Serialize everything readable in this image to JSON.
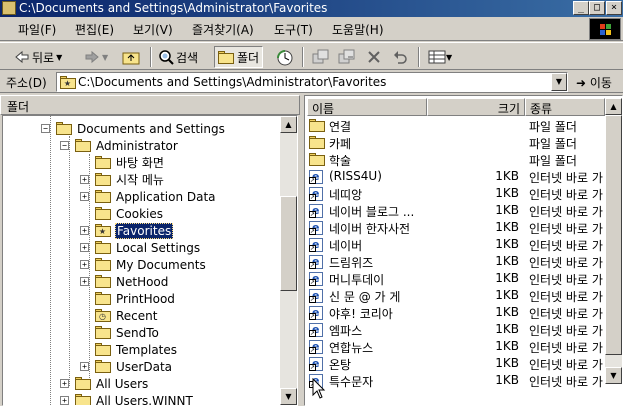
{
  "window": {
    "title": "C:\\Documents and Settings\\Administrator\\Favorites",
    "minimize": "_",
    "maximize": "□",
    "close": "×"
  },
  "menu": [
    {
      "label": "파일(F)"
    },
    {
      "label": "편집(E)"
    },
    {
      "label": "보기(V)"
    },
    {
      "label": "즐겨찾기(A)"
    },
    {
      "label": "도구(T)"
    },
    {
      "label": "도움말(H)"
    }
  ],
  "toolbar": {
    "back_label": "뒤로",
    "search_label": "검색",
    "folders_label": "폴더"
  },
  "address": {
    "label": "주소(D)",
    "value": "C:\\Documents and Settings\\Administrator\\Favorites",
    "go_label": "이동"
  },
  "folder_pane": {
    "header": "폴더",
    "items": [
      {
        "label": "Documents and Settings"
      },
      {
        "label": "Administrator"
      },
      {
        "label": "바탕 화면"
      },
      {
        "label": "시작 메뉴"
      },
      {
        "label": "Application Data"
      },
      {
        "label": "Cookies"
      },
      {
        "label": "Favorites"
      },
      {
        "label": "Local Settings"
      },
      {
        "label": "My Documents"
      },
      {
        "label": "NetHood"
      },
      {
        "label": "PrintHood"
      },
      {
        "label": "Recent"
      },
      {
        "label": "SendTo"
      },
      {
        "label": "Templates"
      },
      {
        "label": "UserData"
      },
      {
        "label": "All Users"
      },
      {
        "label": "All Users.WINNT"
      }
    ]
  },
  "file_list": {
    "columns": {
      "name": "이름",
      "size": "크기",
      "type": "종류"
    },
    "rows": [
      {
        "name": "연결",
        "size": "",
        "type": "파일 폴더",
        "icon": "folder-icon"
      },
      {
        "name": "카페",
        "size": "",
        "type": "파일 폴더",
        "icon": "folder-icon"
      },
      {
        "name": "학술",
        "size": "",
        "type": "파일 폴더",
        "icon": "folder-icon"
      },
      {
        "name": "(RISS4U)",
        "size": "1KB",
        "type": "인터넷 바로 가",
        "icon": "internet-shortcut-icon"
      },
      {
        "name": "네띠앙",
        "size": "1KB",
        "type": "인터넷 바로 가",
        "icon": "internet-shortcut-icon"
      },
      {
        "name": "네이버 블로그 ...",
        "size": "1KB",
        "type": "인터넷 바로 가",
        "icon": "internet-shortcut-icon"
      },
      {
        "name": "네이버 한자사전",
        "size": "1KB",
        "type": "인터넷 바로 가",
        "icon": "internet-shortcut-icon"
      },
      {
        "name": "네이버",
        "size": "1KB",
        "type": "인터넷 바로 가",
        "icon": "internet-shortcut-icon"
      },
      {
        "name": "드림위즈",
        "size": "1KB",
        "type": "인터넷 바로 가",
        "icon": "internet-shortcut-icon"
      },
      {
        "name": "머니투데이",
        "size": "1KB",
        "type": "인터넷 바로 가",
        "icon": "internet-shortcut-icon"
      },
      {
        "name": "신 문 @ 가 게",
        "size": "1KB",
        "type": "인터넷 바로 가",
        "icon": "internet-shortcut-icon"
      },
      {
        "name": "야후! 코리아",
        "size": "1KB",
        "type": "인터넷 바로 가",
        "icon": "internet-shortcut-icon"
      },
      {
        "name": "엠파스",
        "size": "1KB",
        "type": "인터넷 바로 가",
        "icon": "internet-shortcut-icon"
      },
      {
        "name": "연합뉴스",
        "size": "1KB",
        "type": "인터넷 바로 가",
        "icon": "internet-shortcut-icon"
      },
      {
        "name": "온탕",
        "size": "1KB",
        "type": "인터넷 바로 가",
        "icon": "internet-shortcut-icon"
      },
      {
        "name": "특수문자",
        "size": "1KB",
        "type": "인터넷 바로 가",
        "icon": "internet-shortcut-icon"
      }
    ]
  },
  "colors": {
    "title_active": "#0a246a",
    "face": "#d4d0c8",
    "selection": "#0a246a"
  }
}
